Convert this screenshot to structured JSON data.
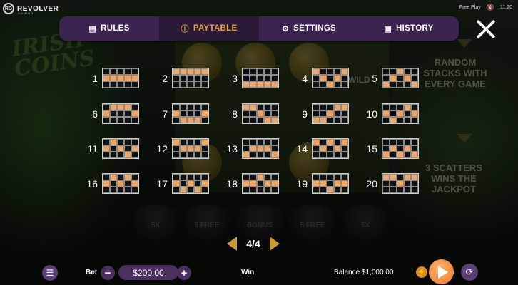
{
  "brand": {
    "name": "REVOLVER",
    "sub": "GAMING",
    "badge": "RG"
  },
  "top": {
    "mode": "Free Play",
    "time": "11:20",
    "mute_glyph": "🔇"
  },
  "background": {
    "title_line1": "IRISH",
    "title_line2": "COINS",
    "random_stacks": "RANDOM STACKS WITH EVERY GAME",
    "scatters": "3 SCATTERS WINS THE JACKPOT",
    "wild": "WILD",
    "pots": [
      "5X",
      "5 FREE",
      "BONUS",
      "5 FREE",
      "5X"
    ]
  },
  "tabs": [
    {
      "label": "RULES",
      "icon": "document-icon",
      "glyph": "▤",
      "active": false
    },
    {
      "label": "PAYTABLE",
      "icon": "info-icon",
      "glyph": "ⓘ",
      "active": true
    },
    {
      "label": "SETTINGS",
      "icon": "gear-icon",
      "glyph": "⚙",
      "active": false
    },
    {
      "label": "HISTORY",
      "icon": "calendar-icon",
      "glyph": "▣",
      "active": false
    }
  ],
  "close_icon": "close-icon",
  "paylines": [
    {
      "n": "1",
      "rows": [
        [
          0,
          0,
          0,
          0,
          0
        ],
        [
          1,
          1,
          1,
          1,
          1
        ],
        [
          0,
          0,
          0,
          0,
          0
        ]
      ]
    },
    {
      "n": "2",
      "rows": [
        [
          1,
          1,
          1,
          1,
          1
        ],
        [
          0,
          0,
          0,
          0,
          0
        ],
        [
          0,
          0,
          0,
          0,
          0
        ]
      ]
    },
    {
      "n": "3",
      "rows": [
        [
          0,
          0,
          0,
          0,
          0
        ],
        [
          0,
          0,
          0,
          0,
          0
        ],
        [
          1,
          1,
          1,
          1,
          1
        ]
      ]
    },
    {
      "n": "4",
      "rows": [
        [
          1,
          0,
          0,
          0,
          1
        ],
        [
          0,
          1,
          0,
          1,
          0
        ],
        [
          0,
          0,
          1,
          0,
          0
        ]
      ]
    },
    {
      "n": "5",
      "rows": [
        [
          0,
          0,
          1,
          0,
          0
        ],
        [
          0,
          1,
          0,
          1,
          0
        ],
        [
          1,
          0,
          0,
          0,
          1
        ]
      ]
    },
    {
      "n": "6",
      "rows": [
        [
          0,
          1,
          1,
          1,
          0
        ],
        [
          1,
          0,
          0,
          0,
          1
        ],
        [
          0,
          0,
          0,
          0,
          0
        ]
      ]
    },
    {
      "n": "7",
      "rows": [
        [
          0,
          0,
          0,
          0,
          0
        ],
        [
          1,
          0,
          0,
          0,
          1
        ],
        [
          0,
          1,
          1,
          1,
          0
        ]
      ]
    },
    {
      "n": "8",
      "rows": [
        [
          1,
          1,
          0,
          0,
          0
        ],
        [
          0,
          0,
          1,
          0,
          0
        ],
        [
          0,
          0,
          0,
          1,
          1
        ]
      ]
    },
    {
      "n": "9",
      "rows": [
        [
          0,
          0,
          0,
          1,
          1
        ],
        [
          0,
          0,
          1,
          0,
          0
        ],
        [
          1,
          1,
          0,
          0,
          0
        ]
      ]
    },
    {
      "n": "10",
      "rows": [
        [
          0,
          0,
          0,
          1,
          0
        ],
        [
          1,
          0,
          1,
          0,
          1
        ],
        [
          0,
          1,
          0,
          0,
          0
        ]
      ]
    },
    {
      "n": "11",
      "rows": [
        [
          0,
          1,
          0,
          0,
          0
        ],
        [
          1,
          0,
          1,
          0,
          1
        ],
        [
          0,
          0,
          0,
          1,
          0
        ]
      ]
    },
    {
      "n": "12",
      "rows": [
        [
          1,
          0,
          0,
          0,
          1
        ],
        [
          0,
          1,
          1,
          1,
          0
        ],
        [
          0,
          0,
          0,
          0,
          0
        ]
      ]
    },
    {
      "n": "13",
      "rows": [
        [
          0,
          0,
          0,
          0,
          0
        ],
        [
          0,
          1,
          1,
          1,
          0
        ],
        [
          1,
          0,
          0,
          0,
          1
        ]
      ]
    },
    {
      "n": "14",
      "rows": [
        [
          1,
          0,
          1,
          0,
          1
        ],
        [
          0,
          1,
          0,
          1,
          0
        ],
        [
          0,
          0,
          0,
          0,
          0
        ]
      ]
    },
    {
      "n": "15",
      "rows": [
        [
          0,
          0,
          0,
          0,
          0
        ],
        [
          0,
          1,
          0,
          1,
          0
        ],
        [
          1,
          0,
          1,
          0,
          1
        ]
      ]
    },
    {
      "n": "16",
      "rows": [
        [
          0,
          1,
          0,
          1,
          0
        ],
        [
          1,
          0,
          1,
          0,
          1
        ],
        [
          0,
          0,
          0,
          0,
          0
        ]
      ]
    },
    {
      "n": "17",
      "rows": [
        [
          0,
          0,
          0,
          0,
          0
        ],
        [
          1,
          0,
          1,
          0,
          1
        ],
        [
          0,
          1,
          0,
          1,
          0
        ]
      ]
    },
    {
      "n": "18",
      "rows": [
        [
          0,
          0,
          1,
          0,
          0
        ],
        [
          1,
          1,
          0,
          1,
          1
        ],
        [
          0,
          0,
          0,
          0,
          0
        ]
      ]
    },
    {
      "n": "19",
      "rows": [
        [
          0,
          0,
          0,
          0,
          0
        ],
        [
          1,
          1,
          0,
          1,
          1
        ],
        [
          0,
          0,
          1,
          0,
          0
        ]
      ]
    },
    {
      "n": "20",
      "rows": [
        [
          1,
          1,
          0,
          1,
          1
        ],
        [
          0,
          0,
          1,
          0,
          0
        ],
        [
          0,
          0,
          0,
          0,
          0
        ]
      ]
    }
  ],
  "pager": {
    "text": "4/4"
  },
  "bottom": {
    "bet_label": "Bet",
    "minus": "−",
    "bet_value": "$200.00",
    "plus": "+",
    "win_label": "Win",
    "balance_text": "Balance $1,000.00",
    "menu_glyph": "☰",
    "bolt_glyph": "⚡",
    "auto_glyph": "⟳"
  },
  "colors": {
    "accent": "#f0a23a",
    "payline_on": "#f7a55c",
    "tab_bar": "#3c2450",
    "spin": "#f07a28"
  }
}
